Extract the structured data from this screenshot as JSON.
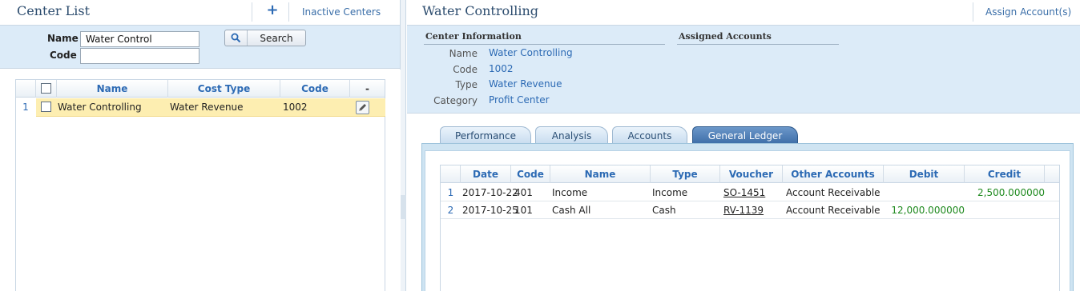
{
  "left_panel": {
    "title": "Center List",
    "add_icon": "plus-icon",
    "inactive_link": "Inactive Centers",
    "filter": {
      "name_label": "Name",
      "name_value": "Water Control",
      "code_label": "Code",
      "code_value": "",
      "search_icon": "magnifier-icon",
      "search_label": "Search"
    },
    "grid": {
      "columns": [
        "Name",
        "Cost Type",
        "Code",
        "-"
      ],
      "rows": [
        {
          "num": "1",
          "name": "Water Controlling",
          "cost_type": "Water Revenue",
          "code": "1002"
        }
      ]
    }
  },
  "right_panel": {
    "title": "Water Controlling",
    "assign_link": "Assign Account(s)",
    "center_info": {
      "heading": "Center Information",
      "fields": [
        {
          "label": "Name",
          "value": "Water Controlling"
        },
        {
          "label": "Code",
          "value": "1002"
        },
        {
          "label": "Type",
          "value": "Water Revenue"
        },
        {
          "label": "Category",
          "value": "Profit Center"
        }
      ]
    },
    "assigned_heading": "Assigned Accounts",
    "tabs": [
      {
        "label": "Performance",
        "active": false
      },
      {
        "label": "Analysis",
        "active": false
      },
      {
        "label": "Accounts",
        "active": false
      },
      {
        "label": "General Ledger",
        "active": true
      }
    ],
    "ledger": {
      "columns": [
        "Date",
        "Code",
        "Name",
        "Type",
        "Voucher",
        "Other Accounts",
        "Debit",
        "Credit"
      ],
      "rows": [
        {
          "num": "1",
          "date": "2017-10-22",
          "code": "401",
          "name": "Income",
          "type": "Income",
          "voucher": "SO-1451",
          "other": "Account Receivable",
          "debit": "",
          "credit": "2,500.000000"
        },
        {
          "num": "2",
          "date": "2017-10-25",
          "code": "101",
          "name": "Cash All",
          "type": "Cash",
          "voucher": "RV-1139",
          "other": "Account Receivable",
          "debit": "12,000.000000",
          "credit": ""
        }
      ]
    }
  },
  "colors": {
    "accent": "#2c6ab4",
    "panel_bg": "#dcebf8",
    "row_highlight": "#fdeeb1",
    "active_tab": "#3e6ea8",
    "money_green": "#1f8a1f"
  }
}
